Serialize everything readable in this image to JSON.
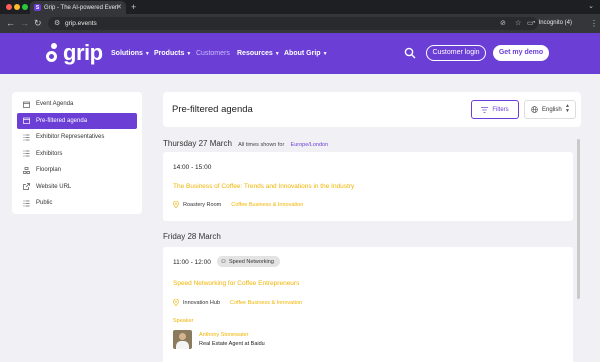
{
  "browser": {
    "tab_title": "Grip - The AI-powered Even",
    "url": "grip.events",
    "incognito_label": "Incognito (4)",
    "colors": {
      "close": "#ff5f57",
      "minimize": "#febc2e",
      "maximize": "#28c840"
    }
  },
  "header": {
    "logo_text": "grip",
    "nav": [
      {
        "label": "Solutions"
      },
      {
        "label": "Products"
      },
      {
        "label": "Customers"
      },
      {
        "label": "Resources"
      },
      {
        "label": "About Grip"
      }
    ],
    "login_label": "Customer login",
    "demo_label": "Get my demo",
    "brand_color": "#6b3fd6"
  },
  "sidebar": {
    "items": [
      {
        "label": "Event Agenda",
        "icon": "calendar-icon"
      },
      {
        "label": "Pre-filtered agenda",
        "icon": "calendar-icon",
        "active": true
      },
      {
        "label": "Exhibitor Representatives",
        "icon": "list-icon"
      },
      {
        "label": "Exhibitors",
        "icon": "list-icon"
      },
      {
        "label": "Floorplan",
        "icon": "floorplan-icon"
      },
      {
        "label": "Website URL",
        "icon": "external-link-icon"
      },
      {
        "label": "Public",
        "icon": "list-icon"
      }
    ]
  },
  "main": {
    "title": "Pre-filtered agenda",
    "filters_label": "Filters",
    "language": "English",
    "days": [
      {
        "date": "Thursday 27 March",
        "note": "All times shown for",
        "timezone": "Europe/London",
        "session": {
          "time": "14:00 - 15:00",
          "title": "The Business of Coffee: Trends and Innovations in the Industry",
          "location": "Roastery Room",
          "track": "Coffee Business & Innovation"
        }
      },
      {
        "date": "Friday 28 March",
        "session": {
          "time": "11:00 - 12:00",
          "badge": "Speed Networking",
          "title": "Speed Networking for Coffee Entrepreneurs",
          "location": "Innovation Hub",
          "track": "Coffee Business & Innovation",
          "speaker_label": "Speaker",
          "speaker_name": "Anthony Stonewater",
          "speaker_role": "Real Estate Agent at Baidu"
        }
      }
    ]
  }
}
